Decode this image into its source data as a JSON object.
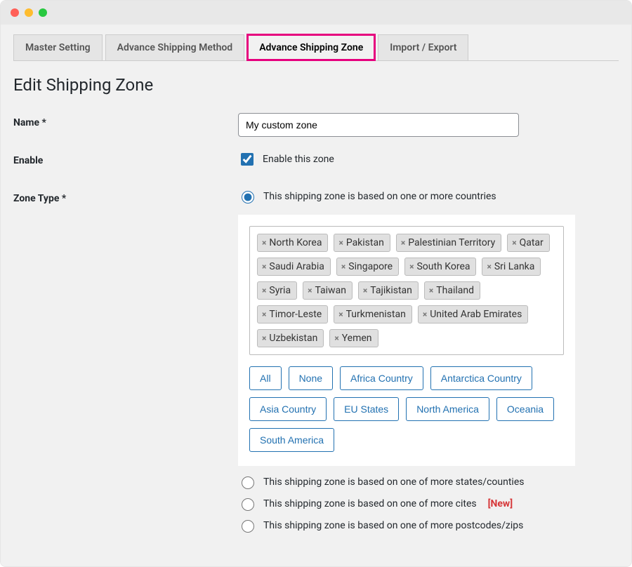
{
  "tabs": [
    {
      "label": "Master Setting",
      "active": false
    },
    {
      "label": "Advance Shipping Method",
      "active": false
    },
    {
      "label": "Advance Shipping Zone",
      "active": true
    },
    {
      "label": "Import / Export",
      "active": false
    }
  ],
  "page_title": "Edit Shipping Zone",
  "fields": {
    "name_label": "Name *",
    "name_value": "My custom zone",
    "enable_label": "Enable",
    "enable_checkbox_label": "Enable this zone",
    "zone_type_label": "Zone Type *"
  },
  "zone_type_options": [
    {
      "label": "This shipping zone is based on one or more countries",
      "checked": true,
      "flag": ""
    },
    {
      "label": "This shipping zone is based on one of more states/counties",
      "checked": false,
      "flag": ""
    },
    {
      "label": "This shipping zone is based on one of more cites",
      "checked": false,
      "flag": "[New]"
    },
    {
      "label": "This shipping zone is based on one of more postcodes/zips",
      "checked": false,
      "flag": ""
    }
  ],
  "selected_countries": [
    "North Korea",
    "Pakistan",
    "Palestinian Territory",
    "Qatar",
    "Saudi Arabia",
    "Singapore",
    "South Korea",
    "Sri Lanka",
    "Syria",
    "Taiwan",
    "Tajikistan",
    "Thailand",
    "Timor-Leste",
    "Turkmenistan",
    "United Arab Emirates",
    "Uzbekistan",
    "Yemen"
  ],
  "quick_select": [
    "All",
    "None",
    "Africa Country",
    "Antarctica Country",
    "Asia Country",
    "EU States",
    "North America",
    "Oceania",
    "South America"
  ]
}
